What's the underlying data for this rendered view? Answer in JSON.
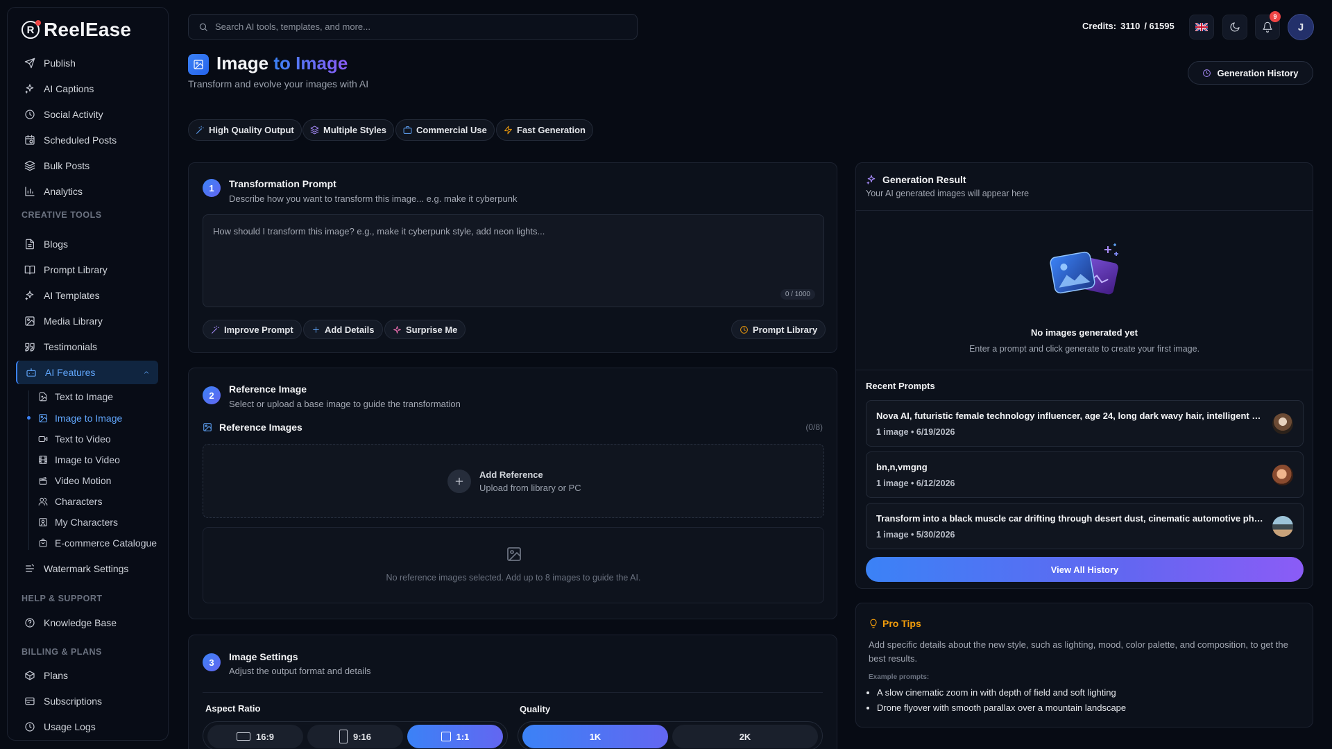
{
  "app": {
    "name": "ReelEase"
  },
  "sidebar": {
    "items": [
      {
        "label": "Publish",
        "icon": "send-icon"
      },
      {
        "label": "AI Captions",
        "icon": "sparkles-icon"
      },
      {
        "label": "Social Activity",
        "icon": "clock-icon"
      },
      {
        "label": "Scheduled Posts",
        "icon": "calendar-clock-icon"
      },
      {
        "label": "Bulk Posts",
        "icon": "layers-icon"
      },
      {
        "label": "Analytics",
        "icon": "bar-chart-icon"
      }
    ],
    "creative_label": "CREATIVE TOOLS",
    "creative_items": [
      {
        "label": "Blogs",
        "icon": "file-icon"
      },
      {
        "label": "Prompt Library",
        "icon": "book-icon"
      },
      {
        "label": "AI Templates",
        "icon": "sparkles-icon"
      },
      {
        "label": "Media Library",
        "icon": "image-icon"
      },
      {
        "label": "Testimonials",
        "icon": "quote-icon"
      }
    ],
    "ai_features": {
      "label": "AI Features",
      "icon": "bot-icon"
    },
    "ai_sub_items": [
      {
        "label": "Text to Image",
        "icon": "file-image-icon"
      },
      {
        "label": "Image to Image",
        "icon": "image-icon",
        "active": true
      },
      {
        "label": "Text to Video",
        "icon": "video-icon"
      },
      {
        "label": "Image to Video",
        "icon": "film-icon"
      },
      {
        "label": "Video Motion",
        "icon": "clapper-icon"
      },
      {
        "label": "Characters",
        "icon": "users-icon"
      },
      {
        "label": "My Characters",
        "icon": "image-user-icon"
      },
      {
        "label": "E-commerce Catalogue",
        "icon": "shopping-bag-icon"
      }
    ],
    "watermark": {
      "label": "Watermark Settings",
      "icon": "watermark-icon"
    },
    "help_label": "HELP & SUPPORT",
    "help_items": [
      {
        "label": "Knowledge Base",
        "icon": "help-circle-icon"
      }
    ],
    "billing_label": "BILLING & PLANS",
    "billing_items": [
      {
        "label": "Plans",
        "icon": "package-icon"
      },
      {
        "label": "Subscriptions",
        "icon": "subscription-icon"
      },
      {
        "label": "Usage Logs",
        "icon": "clock-icon"
      }
    ]
  },
  "topbar": {
    "search_placeholder": "Search AI tools, templates, and more...",
    "credits_label": "Credits:",
    "credits_used": "3110",
    "credits_total": "/ 61595",
    "notifications_count": "9",
    "avatar_initial": "J"
  },
  "page": {
    "title_main": "Image",
    "title_accent": "to Image",
    "subtitle": "Transform and evolve your images with AI",
    "history_button": "Generation History",
    "features": [
      {
        "label": "High Quality Output",
        "icon": "wand-icon",
        "color": "#60a5fa"
      },
      {
        "label": "Multiple Styles",
        "icon": "layers-icon",
        "color": "#a78bfa"
      },
      {
        "label": "Commercial Use",
        "icon": "briefcase-icon",
        "color": "#60a5fa"
      },
      {
        "label": "Fast Generation",
        "icon": "zap-icon",
        "color": "#f59e0b"
      }
    ]
  },
  "prompt_card": {
    "step": "1",
    "title": "Transformation Prompt",
    "subtitle": "Describe how you want to transform this image... e.g. make it cyberpunk",
    "placeholder": "How should I transform this image? e.g., make it cyberpunk style, add neon lights...",
    "counter": "0 / 1000",
    "actions": [
      {
        "label": "Improve Prompt",
        "icon": "wand-icon"
      },
      {
        "label": "Add Details",
        "icon": "plus-icon"
      },
      {
        "label": "Surprise Me",
        "icon": "sparkle-icon"
      }
    ],
    "library_button": "Prompt Library"
  },
  "reference_card": {
    "step": "2",
    "title": "Reference Image",
    "subtitle": "Select or upload a base image to guide the transformation",
    "section_label": "Reference Images",
    "count": "(0/8)",
    "add_title": "Add Reference",
    "add_sub": "Upload from library or PC",
    "empty_text": "No reference images selected. Add up to 8 images to guide the AI."
  },
  "settings_card": {
    "step": "3",
    "title": "Image Settings",
    "subtitle": "Adjust the output format and details",
    "aspect_label": "Aspect Ratio",
    "aspect_options": [
      "16:9",
      "9:16",
      "1:1"
    ],
    "aspect_selected": "1:1",
    "quality_label": "Quality",
    "quality_options": [
      "1K",
      "2K"
    ],
    "quality_selected": "1K"
  },
  "result_card": {
    "title": "Generation Result",
    "subtitle": "Your AI generated images will appear here",
    "empty_title": "No images generated yet",
    "empty_sub": "Enter a prompt and click generate to create your first image.",
    "recent_label": "Recent Prompts",
    "recent": [
      {
        "text": "Nova AI, futuristic female technology influencer, age 24, long dark wavy hair, intelligent and confident expression",
        "meta": "1 image • 6/19/2026"
      },
      {
        "text": "bn,n,vmgng",
        "meta": "1 image • 6/12/2026"
      },
      {
        "text": "Transform into a black muscle car drifting through desert dust, cinematic automotive photography",
        "meta": "1 image • 5/30/2026"
      }
    ],
    "view_all": "View All History"
  },
  "tips_card": {
    "title": "Pro Tips",
    "text": "Add specific details about the new style, such as lighting, mood, color palette, and composition, to get the best results.",
    "examples_label": "Example prompts:",
    "examples": [
      "A slow cinematic zoom in with depth of field and soft lighting",
      "Drone flyover with smooth parallax over a mountain landscape"
    ]
  },
  "colors": {
    "accent": "#3b82f6",
    "accent2": "#8b5cf6",
    "bg": "#070b14",
    "tips": "#f59e0b"
  }
}
